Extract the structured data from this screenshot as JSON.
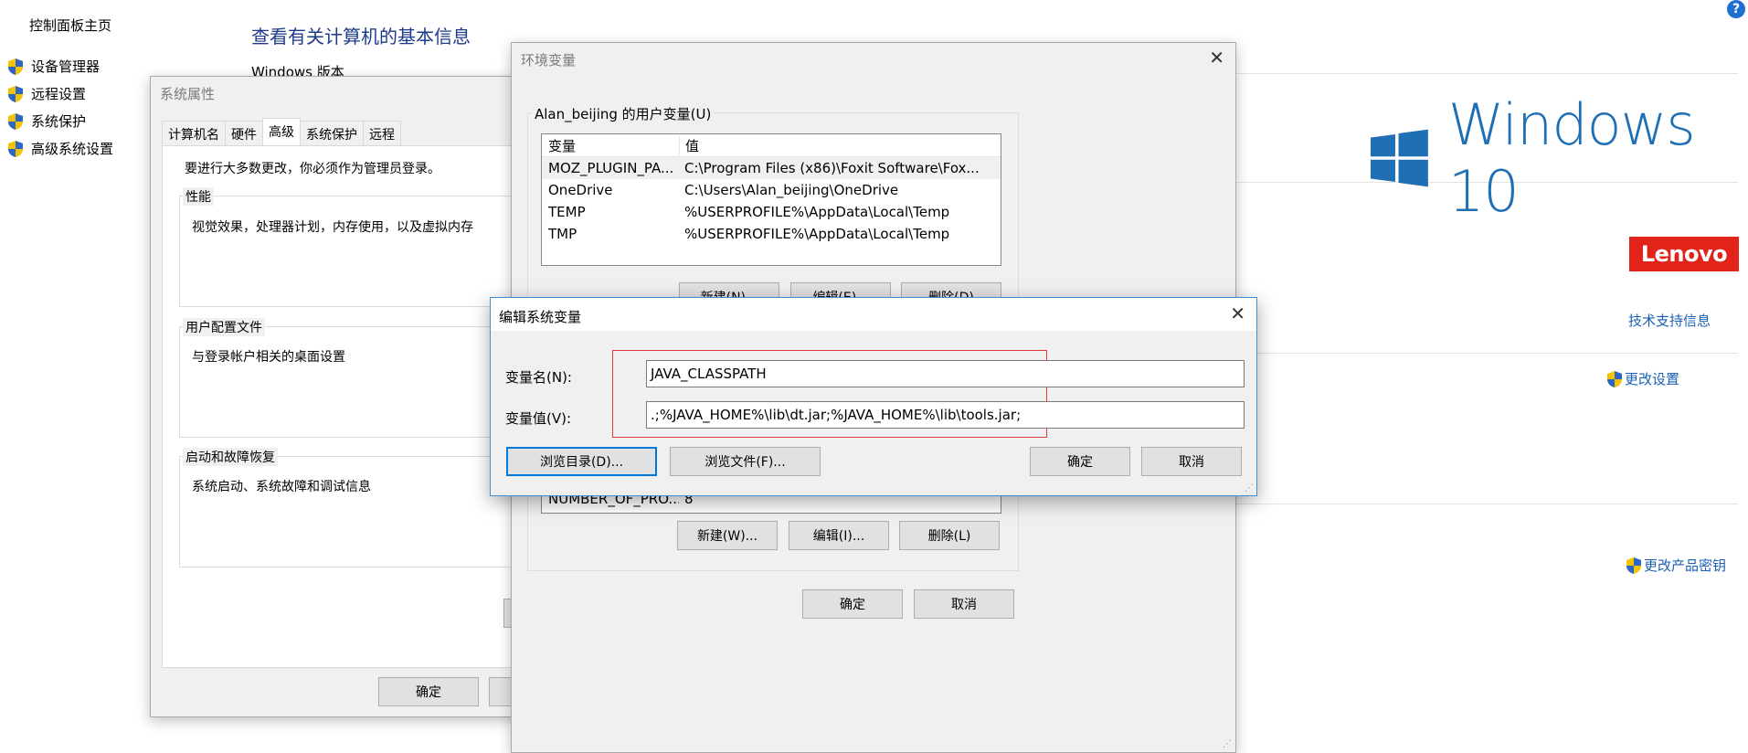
{
  "control_panel": {
    "home_link": "控制面板主页",
    "side_links": [
      "设备管理器",
      "远程设置",
      "系统保护",
      "高级系统设置"
    ],
    "page_title": "查看有关计算机的基本信息",
    "windows_version_heading": "Windows 版本",
    "windows_brand": "Windows 10",
    "oem_logo": "Lenovo",
    "tech_support_link": "技术支持信息",
    "change_settings_link": "更改设置",
    "change_product_key_link": "更改产品密钥",
    "help_glyph": "?"
  },
  "system_properties": {
    "title": "系统属性",
    "tabs": [
      "计算机名",
      "硬件",
      "高级",
      "系统保护",
      "远程"
    ],
    "active_tab": "高级",
    "admin_note": "要进行大多数更改，你必须作为管理员登录。",
    "performance": {
      "label": "性能",
      "desc": "视觉效果，处理器计划，内存使用，以及虚拟内存"
    },
    "user_profiles": {
      "label": "用户配置文件",
      "desc": "与登录帐户相关的桌面设置"
    },
    "startup_recovery": {
      "label": "启动和故障恢复",
      "desc": "系统启动、系统故障和调试信息"
    },
    "ok_button": "确定"
  },
  "environment_variables": {
    "title": "环境变量",
    "user_vars_label": "Alan_beijing 的用户变量(U)",
    "columns": [
      "变量",
      "值"
    ],
    "user_vars": [
      {
        "name": "MOZ_PLUGIN_PA...",
        "value": "C:\\Program Files (x86)\\Foxit Software\\Fox..."
      },
      {
        "name": "OneDrive",
        "value": "C:\\Users\\Alan_beijing\\OneDrive"
      },
      {
        "name": "TEMP",
        "value": "%USERPROFILE%\\AppData\\Local\\Temp"
      },
      {
        "name": "TMP",
        "value": "%USERPROFILE%\\AppData\\Local\\Temp"
      }
    ],
    "user_buttons": [
      "新建(N)...",
      "编辑(E)...",
      "删除(D)"
    ],
    "sys_row_partial": {
      "name": "NUMBER_OF_PRO...",
      "value": "8"
    },
    "sys_buttons": [
      "新建(W)...",
      "编辑(I)...",
      "删除(L)"
    ],
    "ok_button": "确定",
    "cancel_button": "取消"
  },
  "edit_dialog": {
    "title": "编辑系统变量",
    "name_label": "变量名(N):",
    "name_value": "JAVA_CLASSPATH",
    "value_label": "变量值(V):",
    "value_value": ".;%JAVA_HOME%\\lib\\dt.jar;%JAVA_HOME%\\lib\\tools.jar;",
    "browse_dir_button": "浏览目录(D)...",
    "browse_file_button": "浏览文件(F)...",
    "ok_button": "确定",
    "cancel_button": "取消"
  },
  "colors": {
    "link_blue": "#1a5fb4",
    "windows_blue": "#1f6fb5",
    "lenovo_red": "#e2231a",
    "highlight_red": "#e33b3b",
    "focus_blue": "#0078d7"
  }
}
